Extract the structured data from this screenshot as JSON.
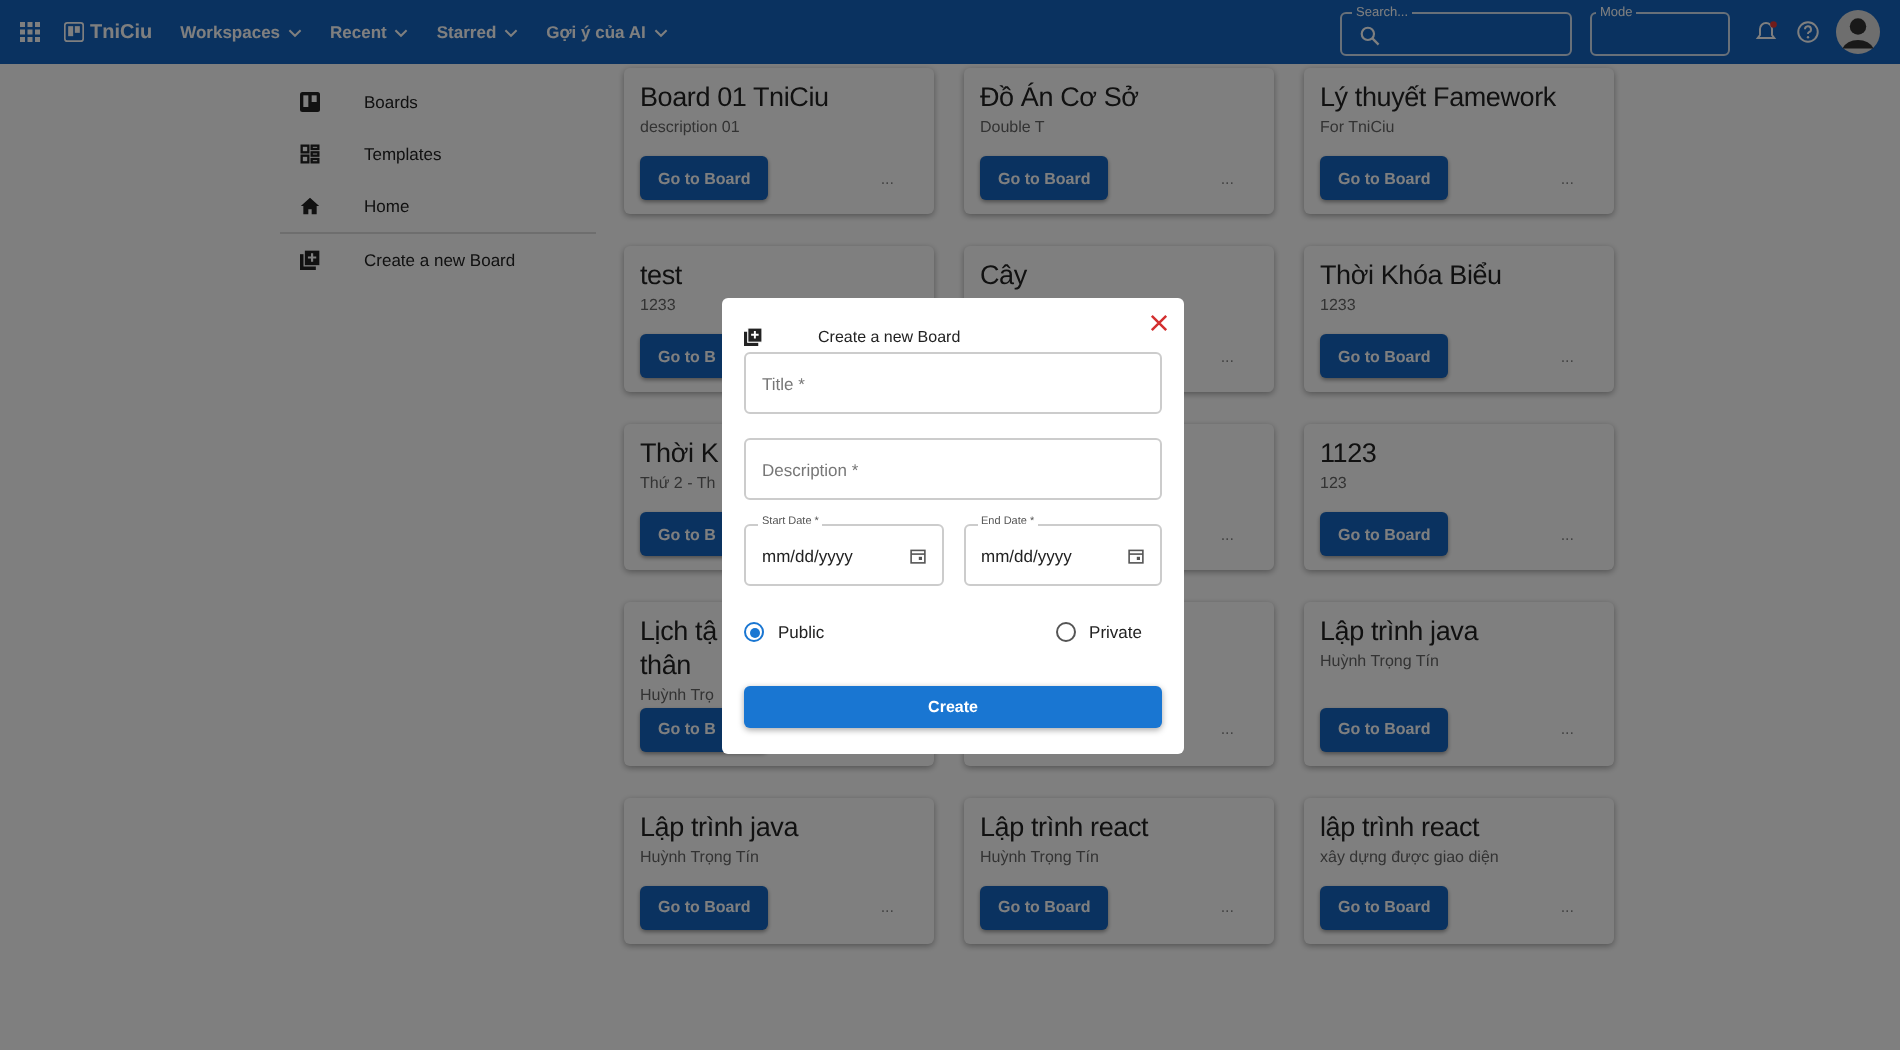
{
  "topbar": {
    "brand": "TniCiu",
    "menus": [
      {
        "label": "Workspaces"
      },
      {
        "label": "Recent"
      },
      {
        "label": "Starred"
      },
      {
        "label": "Gợi ý của AI"
      }
    ],
    "search": {
      "label": "Search..."
    },
    "mode": {
      "label": "Mode"
    },
    "notifications": {
      "unread": true
    }
  },
  "sidebar": {
    "items": [
      {
        "label": "Boards",
        "kind": "board"
      },
      {
        "label": "Templates",
        "kind": "templates"
      },
      {
        "label": "Home",
        "kind": "home"
      },
      {
        "label": "Create a new Board",
        "kind": "add",
        "divider_before": true
      }
    ]
  },
  "boards": [
    {
      "title": "Board 01 TniCiu",
      "description": "description 01",
      "button": "Go to Board",
      "more": "..."
    },
    {
      "title": "Đồ Án Cơ Sở",
      "description": "Double T",
      "button": "Go to Board",
      "more": "..."
    },
    {
      "title": "Lý thuyết Famework",
      "description": "For TniCiu",
      "button": "Go to Board",
      "more": "..."
    },
    {
      "title": "test",
      "description": "1233",
      "button": "Go to B"
    },
    {
      "title": "Cây",
      "more": "..."
    },
    {
      "title": "Thời Khóa Biểu",
      "description": "1233",
      "button": "Go to Board",
      "more": "..."
    },
    {
      "title": "Thời K",
      "description": "Thứ 2 - Th",
      "button": "Go to B"
    },
    {
      "more": "..."
    },
    {
      "title": "1123",
      "description": "123",
      "button": "Go to Board",
      "more": "..."
    },
    {
      "title": "Lịch tậ\nthân",
      "description": "Huỳnh Trọ",
      "button": "Go to B"
    },
    {
      "more": "..."
    },
    {
      "title": "Lập trình java",
      "description": "Huỳnh Trọng Tín",
      "button": "Go to Board",
      "more": "..."
    },
    {
      "title": "Lập trình java",
      "description": "Huỳnh Trọng Tín",
      "button": "Go to Board",
      "more": "..."
    },
    {
      "title": "Lập trình react",
      "description": "Huỳnh Trọng Tín",
      "button": "Go to Board",
      "more": "..."
    },
    {
      "title": "lập trình react",
      "description": "xây dựng được giao diện",
      "button": "Go to Board",
      "more": "..."
    }
  ],
  "dialog": {
    "title": "Create a new Board",
    "fields": [
      {
        "kind": "text",
        "placeholder": "Title *"
      },
      {
        "kind": "text",
        "placeholder": "Description *"
      }
    ],
    "dates": [
      {
        "label": "Start Date *",
        "value": "mm/dd/yyyy"
      },
      {
        "label": "End Date *",
        "value": "mm/dd/yyyy"
      }
    ],
    "visibility": [
      {
        "label": "Public",
        "selected": true
      },
      {
        "label": "Private",
        "selected": false
      }
    ],
    "submit": "Create"
  }
}
